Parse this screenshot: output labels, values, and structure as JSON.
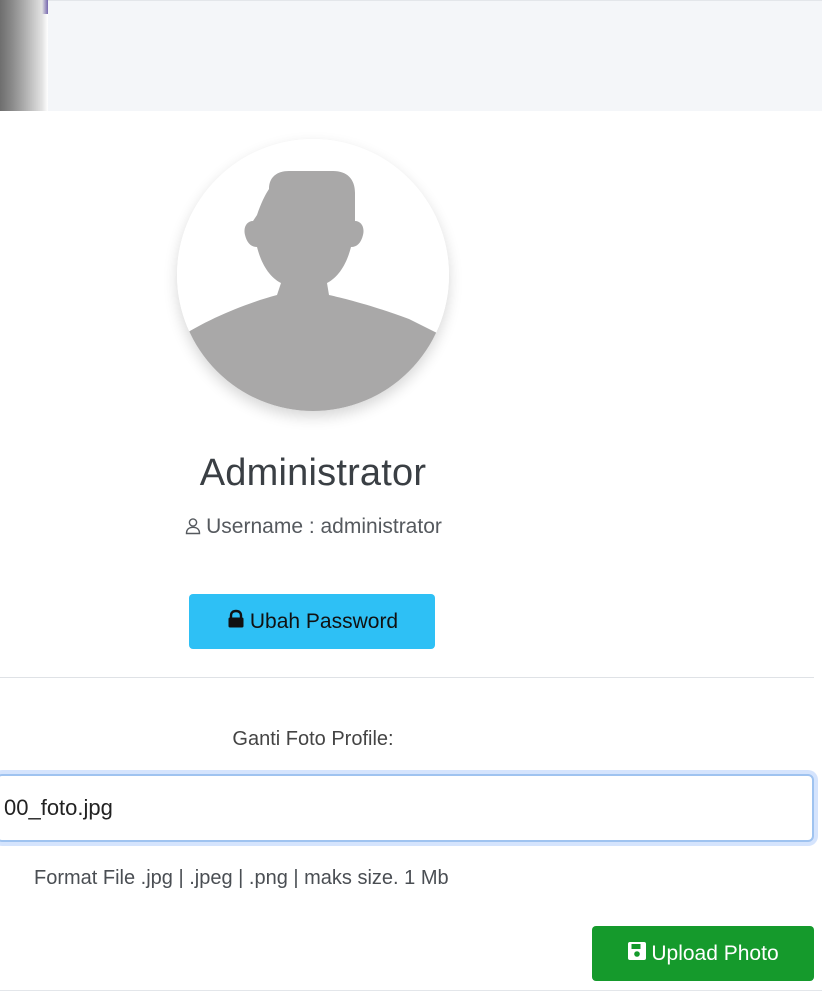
{
  "profile": {
    "name": "Administrator",
    "username_text": "Username : administrator",
    "change_password_label": "Ubah Password"
  },
  "upload": {
    "label": "Ganti Foto Profile:",
    "file_value": "00_foto.jpg",
    "format_hint": "Format File .jpg | .jpeg | .png | maks size. 1 Mb",
    "button_label": "Upload Photo"
  },
  "icons": {
    "avatar": "default-user-silhouette",
    "username": "user-icon",
    "password_button": "lock-icon",
    "upload_button": "save-icon"
  },
  "colors": {
    "info_button": "#2ec0f5",
    "success_button": "#159a2c",
    "avatar_silhouette": "#a9a8a8",
    "header_bg": "#f4f6f9"
  }
}
